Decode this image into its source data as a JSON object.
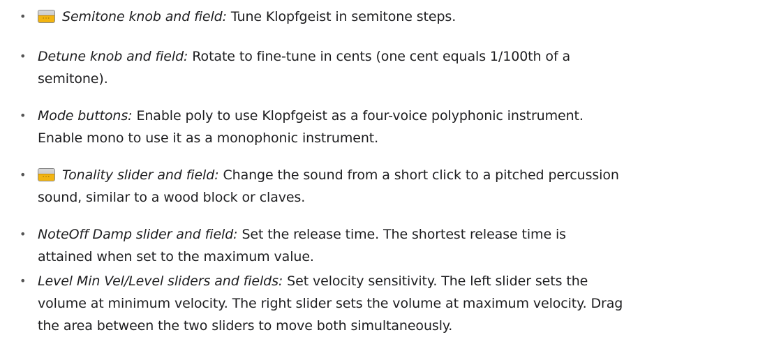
{
  "items": [
    {
      "has_icon": true,
      "icon": "quick-access-icon",
      "term": "Semitone knob and field:",
      "description": "Tune Klopfgeist in semitone steps.",
      "continuation": ""
    },
    {
      "has_icon": false,
      "term": "Detune knob and field:",
      "description": "Rotate to fine-tune in cents (one cent equals 1/100th of a",
      "continuation": "semitone)."
    },
    {
      "has_icon": false,
      "term": "Mode buttons:",
      "description": "Enable poly to use Klopfgeist as a four-voice polyphonic instrument.",
      "continuation": "Enable mono to use it as a monophonic instrument."
    },
    {
      "has_icon": true,
      "icon": "quick-access-icon",
      "term": "Tonality slider and field:",
      "description": "Change the sound from a short click to a pitched percussion",
      "continuation": "sound, similar to a wood block or claves."
    },
    {
      "has_icon": false,
      "term": "NoteOff Damp slider and field:",
      "description": "Set the release time. The shortest release time is",
      "continuation": "attained when set to the maximum value."
    },
    {
      "has_icon": false,
      "term": "Level Min Vel/Level sliders and fields:",
      "description": "Set velocity sensitivity. The left slider sets the",
      "continuation": "volume at minimum velocity. The right slider sets the volume at maximum velocity. Drag",
      "continuation2": "the area between the two sliders to move both simultaneously."
    }
  ]
}
